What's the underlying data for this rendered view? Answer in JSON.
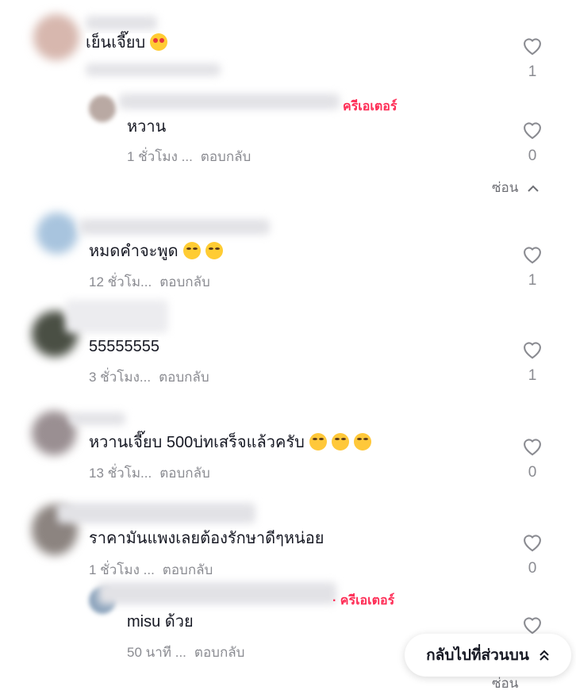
{
  "comments": [
    {
      "text": "เย็นเจี๊ยบ",
      "emojis": [
        "heart-eyes"
      ],
      "time": "",
      "reply": "",
      "likes": "1"
    },
    {
      "text": "หวาน",
      "creator_badge": "ครีเอเตอร์",
      "time": "1 ชั่วโมง ...",
      "reply": "ตอบกลับ",
      "likes": "0"
    },
    {
      "text": "หมดคำจะพูด",
      "emojis": [
        "laugh",
        "laugh"
      ],
      "time": "12 ชั่วโม...",
      "reply": "ตอบกลับ",
      "likes": "1"
    },
    {
      "text": "55555555",
      "time": "3 ชั่วโมง...",
      "reply": "ตอบกลับ",
      "likes": "1"
    },
    {
      "text": "หวานเจี๊ยบ 500บ่ทเสร็จแล้วครับ",
      "emojis": [
        "sweat",
        "sweat",
        "sweat"
      ],
      "time": "13 ชั่วโม...",
      "reply": "ตอบกลับ",
      "likes": "0"
    },
    {
      "text": "ราคามันแพงเลยต้องรักษาดีๆหน่อย",
      "time": "1 ชั่วโมง ...",
      "reply": "ตอบกลับ",
      "likes": "0"
    },
    {
      "text": "misu ด้วย",
      "creator_badge": "· ครีเอเตอร์",
      "time": "50 นาที ...",
      "reply": "ตอบกลับ",
      "likes": ""
    }
  ],
  "hide_label": "ซ่อน",
  "hide_bottom_label": "ซ่อน",
  "back_to_top_label": "กลับไปที่ส่วนบน",
  "colors": {
    "creator": "#fe2c55",
    "meta": "#8a8b91",
    "text": "#161823"
  }
}
